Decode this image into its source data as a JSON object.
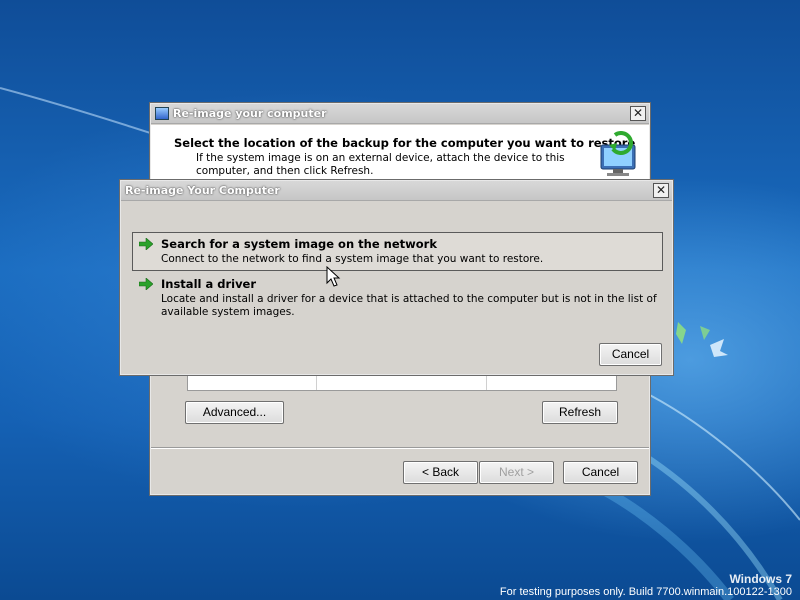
{
  "back_window": {
    "title": "Re-image your computer",
    "header_title": "Select the location of the backup for the computer you want to restore",
    "header_desc": "If the system image is on an external device, attach the device to this computer, and then click Refresh.",
    "advanced_label": "Advanced...",
    "refresh_label": "Refresh",
    "back_label": "< Back",
    "next_label": "Next >",
    "cancel_label": "Cancel",
    "close_glyph": "✕"
  },
  "front_dialog": {
    "title": "Re-image Your Computer",
    "close_glyph": "✕",
    "options": [
      {
        "title": "Search for a system image on the network",
        "desc": "Connect to the network to find a system image that you want to restore.",
        "icon": "green-arrow-icon"
      },
      {
        "title": "Install a driver",
        "desc": "Locate and install a driver for a device that is attached to the computer but is not in the list of available system images.",
        "icon": "green-arrow-icon"
      }
    ],
    "cancel_label": "Cancel"
  },
  "watermark": {
    "title": "Windows 7",
    "build": "For testing purposes only. Build 7700.winmain.100122-1300"
  },
  "colors": {
    "desktop": "#1a5faa",
    "dialog": "#d6d3ce",
    "accent_arrow": "#2aa12a"
  }
}
